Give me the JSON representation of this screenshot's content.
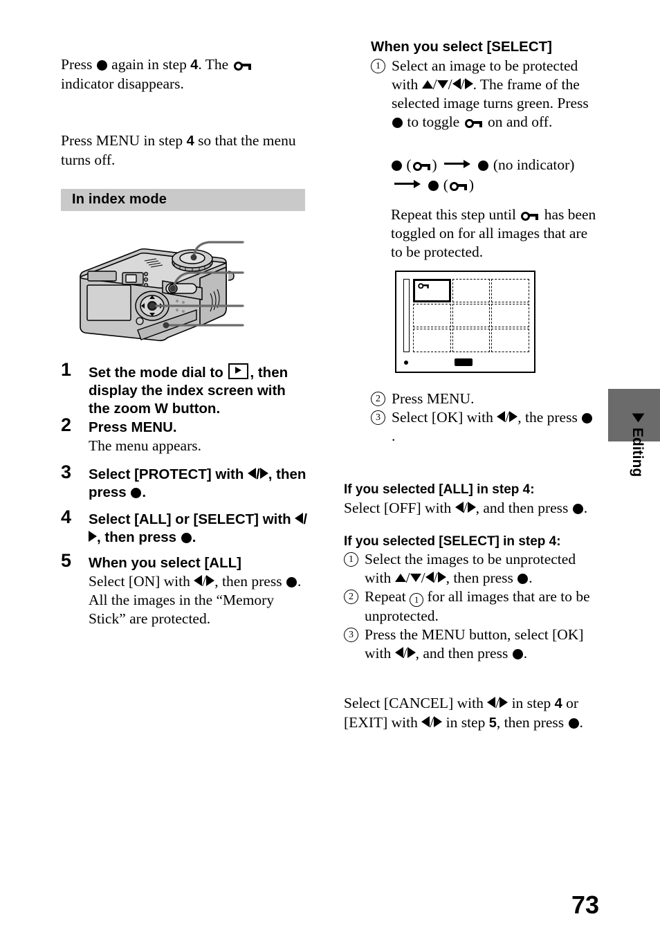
{
  "page": {
    "number": "73",
    "side_tab_label": "Editing"
  },
  "left_column": {
    "para_cancel_single": {
      "line1_a": "Press ",
      "line1_b": " again in step ",
      "line1_step": "4",
      "line1_c": ". The ",
      "line2": "indicator disappears."
    },
    "para_menu_off": {
      "line1_a": "Press MENU in step ",
      "line1_step": "4",
      "line1_b": " so that the menu",
      "line2": "turns off."
    },
    "section_title": "In index mode",
    "steps": [
      {
        "num": "1",
        "head_a": "Set the mode dial to ",
        "head_b": ", then display the index screen with the zoom W button.",
        "sub": ""
      },
      {
        "num": "2",
        "head_a": "Press MENU.",
        "head_b": "",
        "sub": "The menu appears."
      },
      {
        "num": "3",
        "head_a": "Select [PROTECT] with ",
        "head_b": ", then press ",
        "head_c": ".",
        "sub": ""
      },
      {
        "num": "4",
        "head_a": "Select [ALL] or [SELECT] with ",
        "head_b": ", then press ",
        "head_c": ".",
        "sub": ""
      },
      {
        "num": "5",
        "head_a": "When you select [ALL]",
        "sub_a": "Select [ON] with ",
        "sub_b": ", then press ",
        "sub_c": ".",
        "sub2": "All the images in the “Memory Stick” are protected."
      }
    ]
  },
  "right_column": {
    "select_heading": "When you select [SELECT]",
    "select_step1": {
      "num": "1",
      "t1": "Select an image to be protected with ",
      "t2": ". The frame of the selected image turns green. Press ",
      "t3": " to toggle ",
      "t4": " on and off."
    },
    "toggle_diagram": {
      "label_no_indicator": "(no indicator)"
    },
    "repeat_note": {
      "a": "Repeat this step until ",
      "b": " has been toggled on for all images that are to be protected."
    },
    "select_step2": {
      "num": "2",
      "text": "Press MENU."
    },
    "select_step3": {
      "num": "3",
      "t1": "Select [OK] with ",
      "t2": ", the press ",
      "t3": "."
    },
    "all_step4_heading": "If you selected [ALL] in step 4:",
    "all_step4_body": {
      "t1": "Select [OFF] with ",
      "t2": ", and then press ",
      "t3": "."
    },
    "select_step4_heading": "If you selected [SELECT] in step 4:",
    "select_step4_items": [
      {
        "num": "1",
        "t1": "Select the images to be unprotected with ",
        "t2": ", then press ",
        "t3": "."
      },
      {
        "num": "2",
        "t1": "Repeat ",
        "inner_num": "1",
        "t2": " for all images that are to be unprotected."
      },
      {
        "num": "3",
        "t1": "Press the MENU button, select [OK] with ",
        "t2": ", and then press ",
        "t3": "."
      }
    ],
    "cancel_note": {
      "t1": "Select [CANCEL] with ",
      "t2": " in step ",
      "step_a": "4",
      "t3": " or [EXIT] with ",
      "t4": " in step ",
      "step_b": "5",
      "t5": ", then press ",
      "t6": "."
    }
  },
  "colors": {
    "section_bar": "#c9c9c9",
    "side_tab_gray": "#6b6b6b",
    "ink": "#000000",
    "paper": "#ffffff"
  }
}
